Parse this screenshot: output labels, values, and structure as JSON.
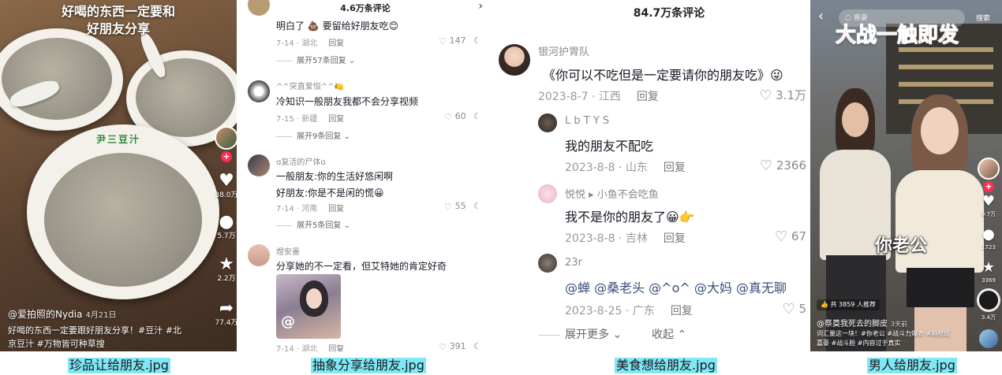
{
  "panels": [
    {
      "caption": "珍品让给朋友.jpg",
      "video": {
        "title_lines": [
          "好喝的东西一定要和",
          "好朋友分享"
        ],
        "bowl_text": "尹三豆汁",
        "likes": "38.0万",
        "comments": "5.7万",
        "favorites": "2.2万",
        "shares": "77.4万",
        "author": "@爱拍照的Nydia",
        "date": "4月21日",
        "desc_lines": [
          "好喝的东西一定要跟好朋友分享！#豆汁 #北",
          "京豆汁 #万物皆可种草搜"
        ]
      }
    },
    {
      "caption": "抽象分享给朋友.jpg",
      "header": "4.6万条评论",
      "comments": [
        {
          "name": "",
          "text": "明白了 💩 要留给好朋友吃😊",
          "date": "7-14 · 湖北",
          "reply": "回复",
          "likes": "147",
          "expand": "展开57条回复"
        },
        {
          "name": "^^突直爱恒^^🍋",
          "text": "冷知识一般朋友我都不会分享视频",
          "date": "7-15 · 新疆",
          "reply": "回复",
          "likes": "60",
          "expand": "展开9条回复"
        },
        {
          "name": "ɑ复活的尸体ɑ",
          "text": "一般朋友:你的生活好悠闲啊",
          "text2": "好朋友:你是不是闲的慌😀",
          "date": "7-14 · 河南",
          "reply": "回复",
          "likes": "55",
          "expand": "展开5条回复"
        },
        {
          "name": "煜安墨",
          "text": "分享她的不一定看，但艾特她的肯定好奇",
          "date": "7-14 · 湖北",
          "reply": "回复",
          "likes": "391",
          "expand": ""
        }
      ]
    },
    {
      "caption": "美食想给朋友.jpg",
      "header": "84.7万条评论",
      "comments": [
        {
          "name": "银河护胃队",
          "text": "《你可以不吃但是一定要请你的朋友吃》😜",
          "date": "2023-8-7 · 江西",
          "reply": "回复",
          "likes": "3.1万"
        },
        {
          "name": "L b T Y S",
          "text": "我的朋友不配吃",
          "date": "2023-8-8 · 山东",
          "reply": "回复",
          "likes": "2366"
        },
        {
          "name": "悦悦 ▸ 小鱼不会吃鱼",
          "text": "我不是你的朋友了😀👉",
          "date": "2023-8-8 · 吉林",
          "reply": "回复",
          "likes": "67"
        },
        {
          "name": "23r",
          "text": "@蝉 @桑老头 @^o^ @大妈 @真无聊",
          "date": "2023-8-25 · 广东",
          "reply": "回复",
          "likes": "5"
        }
      ],
      "expand_more": "展开更多",
      "collapse": "收起"
    },
    {
      "caption": "男人给朋友.jpg",
      "video": {
        "search_label": "搜索",
        "search_placeholder": "喜豪",
        "headline": "大战一触即发",
        "subtitle": "你老公",
        "likes": "9.7万",
        "comments": "1723",
        "favorites": "3369",
        "shares": "3.4万",
        "recommend": "共 3859 人推荐",
        "author": "@祭奠我死去的脚皮",
        "date": "3天前",
        "desc_lines": [
          "词汇量这一块！#你老公 #战斗力爆表 #隔壁班",
          "嘉豪 #战斗脸 #内容过于真实"
        ]
      }
    }
  ]
}
